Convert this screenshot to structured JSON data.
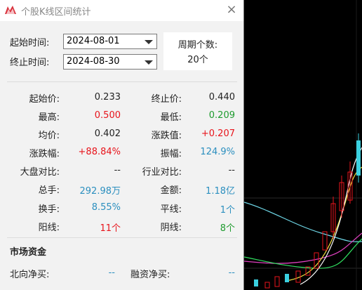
{
  "window": {
    "title": "个股K线区间统计",
    "close_glyph": "×"
  },
  "range": {
    "start_label": "起始时间:",
    "start_value": "2024-08-01",
    "end_label": "终止时间:",
    "end_value": "2024-08-30",
    "period_label": "周期个数:",
    "period_value": "20个"
  },
  "stats": {
    "start_price": {
      "label": "起始价:",
      "value": "0.233"
    },
    "end_price": {
      "label": "终止价:",
      "value": "0.440"
    },
    "high": {
      "label": "最高:",
      "value": "0.500"
    },
    "low": {
      "label": "最低:",
      "value": "0.209"
    },
    "avg": {
      "label": "均价:",
      "value": "0.402"
    },
    "change": {
      "label": "涨跌值:",
      "value": "+0.207"
    },
    "change_pct": {
      "label": "涨跌幅:",
      "value": "+88.84%"
    },
    "amplitude": {
      "label": "振幅:",
      "value": "124.9%"
    },
    "vs_market": {
      "label": "大盘对比:",
      "value": "--"
    },
    "vs_industry": {
      "label": "行业对比:",
      "value": "--"
    },
    "volume": {
      "label": "总手:",
      "value": "292.98万"
    },
    "amount": {
      "label": "金额:",
      "value": "1.18亿"
    },
    "turnover": {
      "label": "换手:",
      "value": "8.55%"
    },
    "flat": {
      "label": "平线:",
      "value": "1个"
    },
    "up": {
      "label": "阳线:",
      "value": "11个"
    },
    "down": {
      "label": "阴线:",
      "value": "8个"
    }
  },
  "market_funds": {
    "title": "市场资金",
    "northbound": {
      "label": "北向净买:",
      "value": "--"
    },
    "margin": {
      "label": "融资净买:",
      "value": "--"
    }
  },
  "colors": {
    "up": "#e8141b",
    "down": "#1e9b2e",
    "neutral": "#2b8fbf",
    "text": "#222222"
  },
  "icons": [
    "app-icon",
    "close-icon",
    "dropdown-arrow-icon"
  ]
}
